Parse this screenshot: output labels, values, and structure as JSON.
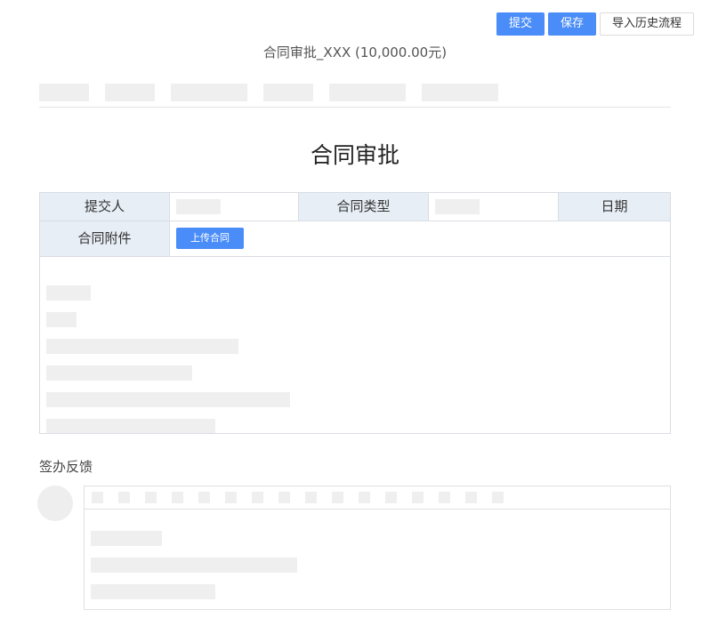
{
  "toolbar": {
    "submit_label": "提交",
    "save_label": "保存",
    "import_label": "导入历史流程"
  },
  "document": {
    "title": "合同审批_XXX (10,000.00元)"
  },
  "form": {
    "title": "合同审批",
    "labels": {
      "submitter": "提交人",
      "contract_type": "合同类型",
      "date": "日期",
      "attachment": "合同附件"
    },
    "upload_label": "上传合同"
  },
  "feedback": {
    "section_title": "签办反馈"
  },
  "colors": {
    "primary": "#4a8df8",
    "label_bg": "#e7eef6",
    "placeholder": "#efefef"
  }
}
